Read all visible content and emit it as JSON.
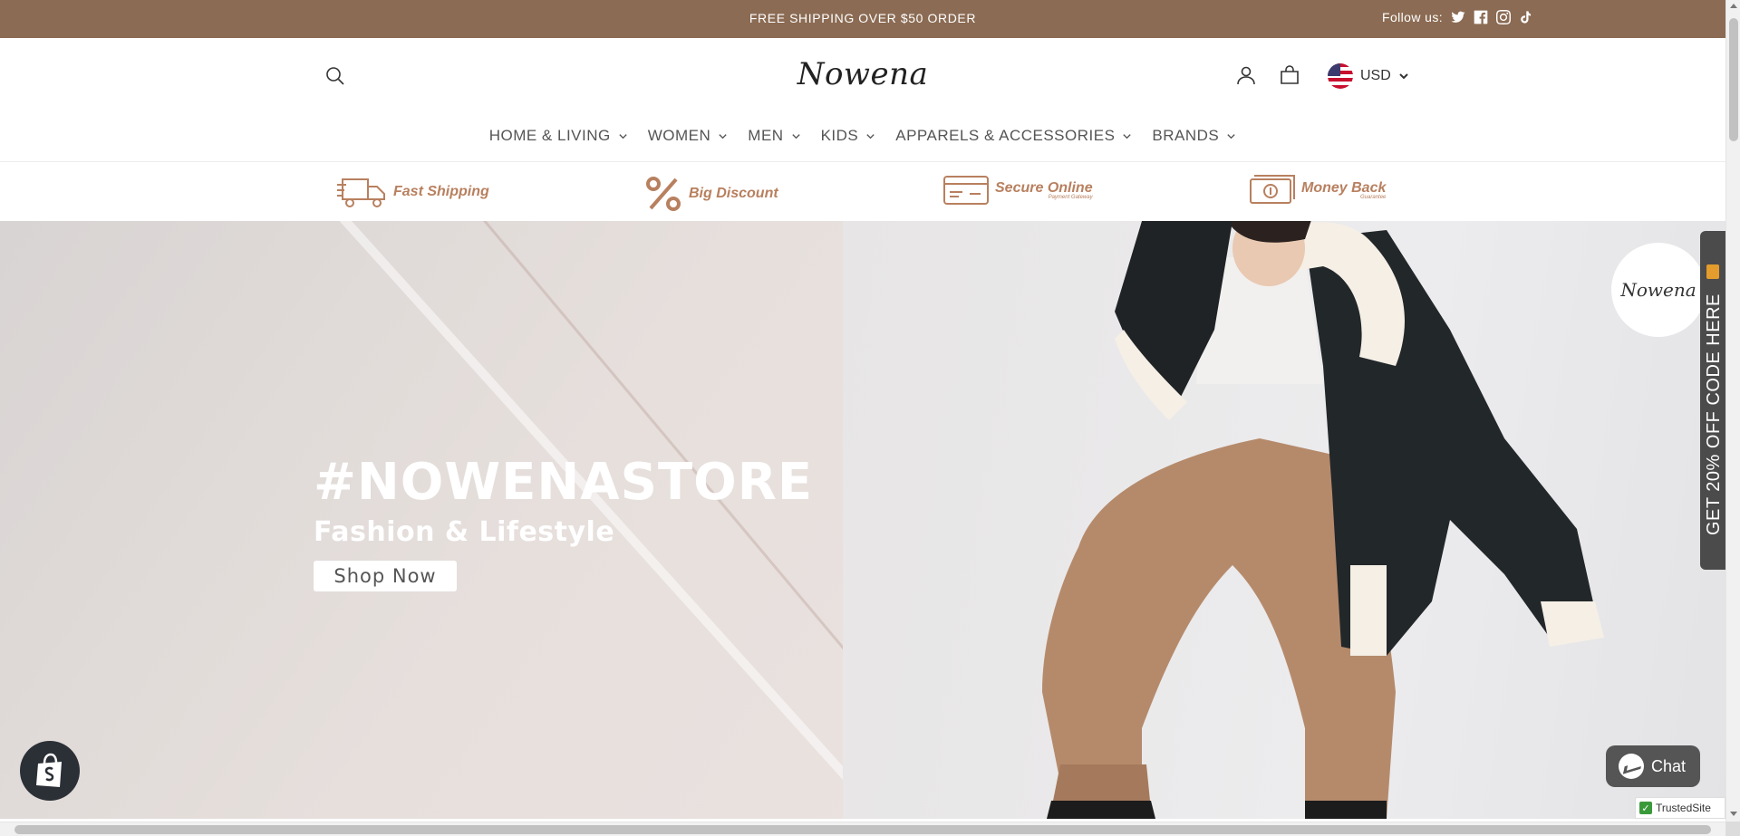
{
  "announcement": {
    "message": "FREE SHIPPING OVER $50 ORDER",
    "follow_label": "Follow us:",
    "social_icons": [
      "twitter-icon",
      "facebook-icon",
      "instagram-icon",
      "tiktok-icon"
    ]
  },
  "header": {
    "logo": "Nowena",
    "currency": "USD"
  },
  "nav": {
    "items": [
      {
        "label": "HOME & LIVING"
      },
      {
        "label": "WOMEN"
      },
      {
        "label": "MEN"
      },
      {
        "label": "KIDS"
      },
      {
        "label": "APPARELS & ACCESSORIES"
      },
      {
        "label": "BRANDS"
      }
    ]
  },
  "features": [
    {
      "title": "Fast Shipping",
      "sub": ""
    },
    {
      "title": "Big Discount",
      "sub": ""
    },
    {
      "title": "Secure Online",
      "sub": "Payment Gateway"
    },
    {
      "title": "Money Back",
      "sub": "Guarantee"
    }
  ],
  "hero": {
    "title": "#NOWENASTORE",
    "subtitle": "Fashion & Lifestyle",
    "button": "Shop Now"
  },
  "promo": {
    "tab_text": "GET 20% OFF CODE HERE",
    "badge_logo": "Nowena"
  },
  "widgets": {
    "chat_label": "Chat",
    "trusted_label": "TrustedSite"
  },
  "colors": {
    "announcement_bg": "#8b6b53",
    "feature_accent": "#b8805f"
  }
}
